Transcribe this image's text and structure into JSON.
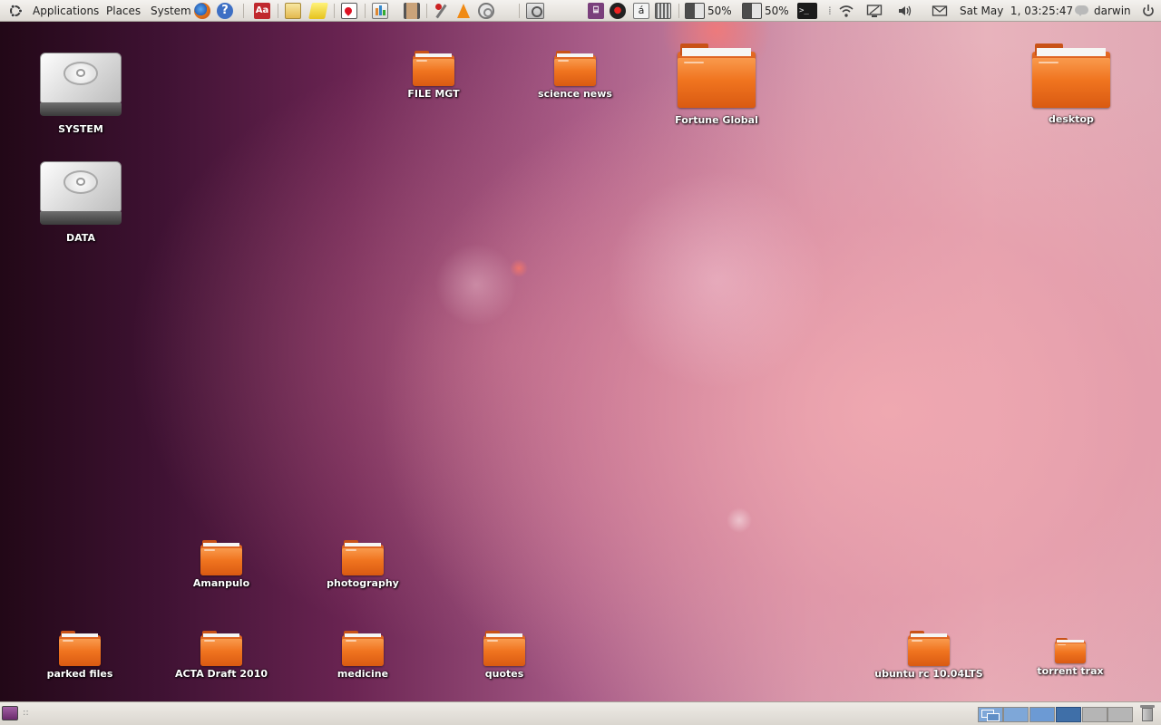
{
  "top_panel": {
    "menus": {
      "applications": "Applications",
      "places": "Places",
      "system": "System"
    },
    "launchers": [
      {
        "name": "firefox-icon"
      },
      {
        "name": "help-icon",
        "glyph": "?"
      },
      {
        "name": "dictionary-icon",
        "glyph": "Aa"
      },
      {
        "name": "files-icon"
      },
      {
        "name": "folder-icon"
      },
      {
        "name": "cards-game-icon"
      },
      {
        "name": "presentation-icon"
      },
      {
        "name": "film-icon"
      },
      {
        "name": "tools-icon"
      },
      {
        "name": "vlc-icon"
      },
      {
        "name": "speaker-icon"
      },
      {
        "name": "screenshot-icon"
      }
    ],
    "tray": {
      "monitor_glyph": "⌸",
      "record_glyph": "●",
      "character_map_glyph": "á",
      "battery1_percent": "50%",
      "battery2_percent": "50%",
      "terminal_glyph": ">_",
      "clock": "Sat May  1, 03:25:47",
      "user": "darwin"
    }
  },
  "desktop": {
    "icons": [
      {
        "label": "SYSTEM",
        "type": "drive"
      },
      {
        "label": "DATA",
        "type": "drive"
      },
      {
        "label": "FILE MGT",
        "type": "folder"
      },
      {
        "label": "science news",
        "type": "folder"
      },
      {
        "label": "Fortune Global",
        "type": "folder"
      },
      {
        "label": "desktop",
        "type": "folder"
      },
      {
        "label": "Amanpulo",
        "type": "folder"
      },
      {
        "label": "photography",
        "type": "folder"
      },
      {
        "label": "parked files",
        "type": "folder"
      },
      {
        "label": "ACTA Draft 2010",
        "type": "folder"
      },
      {
        "label": "medicine",
        "type": "folder"
      },
      {
        "label": "quotes",
        "type": "folder"
      },
      {
        "label": "ubuntu rc 10.04LTS",
        "type": "folder"
      },
      {
        "label": "torrent trax",
        "type": "folder"
      }
    ]
  },
  "bottom_panel": {
    "handle_glyph": "::",
    "workspaces": [
      {
        "name": "workspace-1",
        "active": false
      },
      {
        "name": "workspace-2",
        "active": false
      },
      {
        "name": "workspace-3",
        "active": false
      },
      {
        "name": "workspace-4",
        "active": true
      },
      {
        "name": "workspace-5",
        "active": false
      },
      {
        "name": "workspace-6",
        "active": false
      }
    ]
  },
  "colors": {
    "folder_orange": "#f0741f",
    "panel_bg": "#e9e6e1",
    "wallpaper_dark": "#3a1330",
    "wallpaper_light": "#e8b3bc"
  }
}
